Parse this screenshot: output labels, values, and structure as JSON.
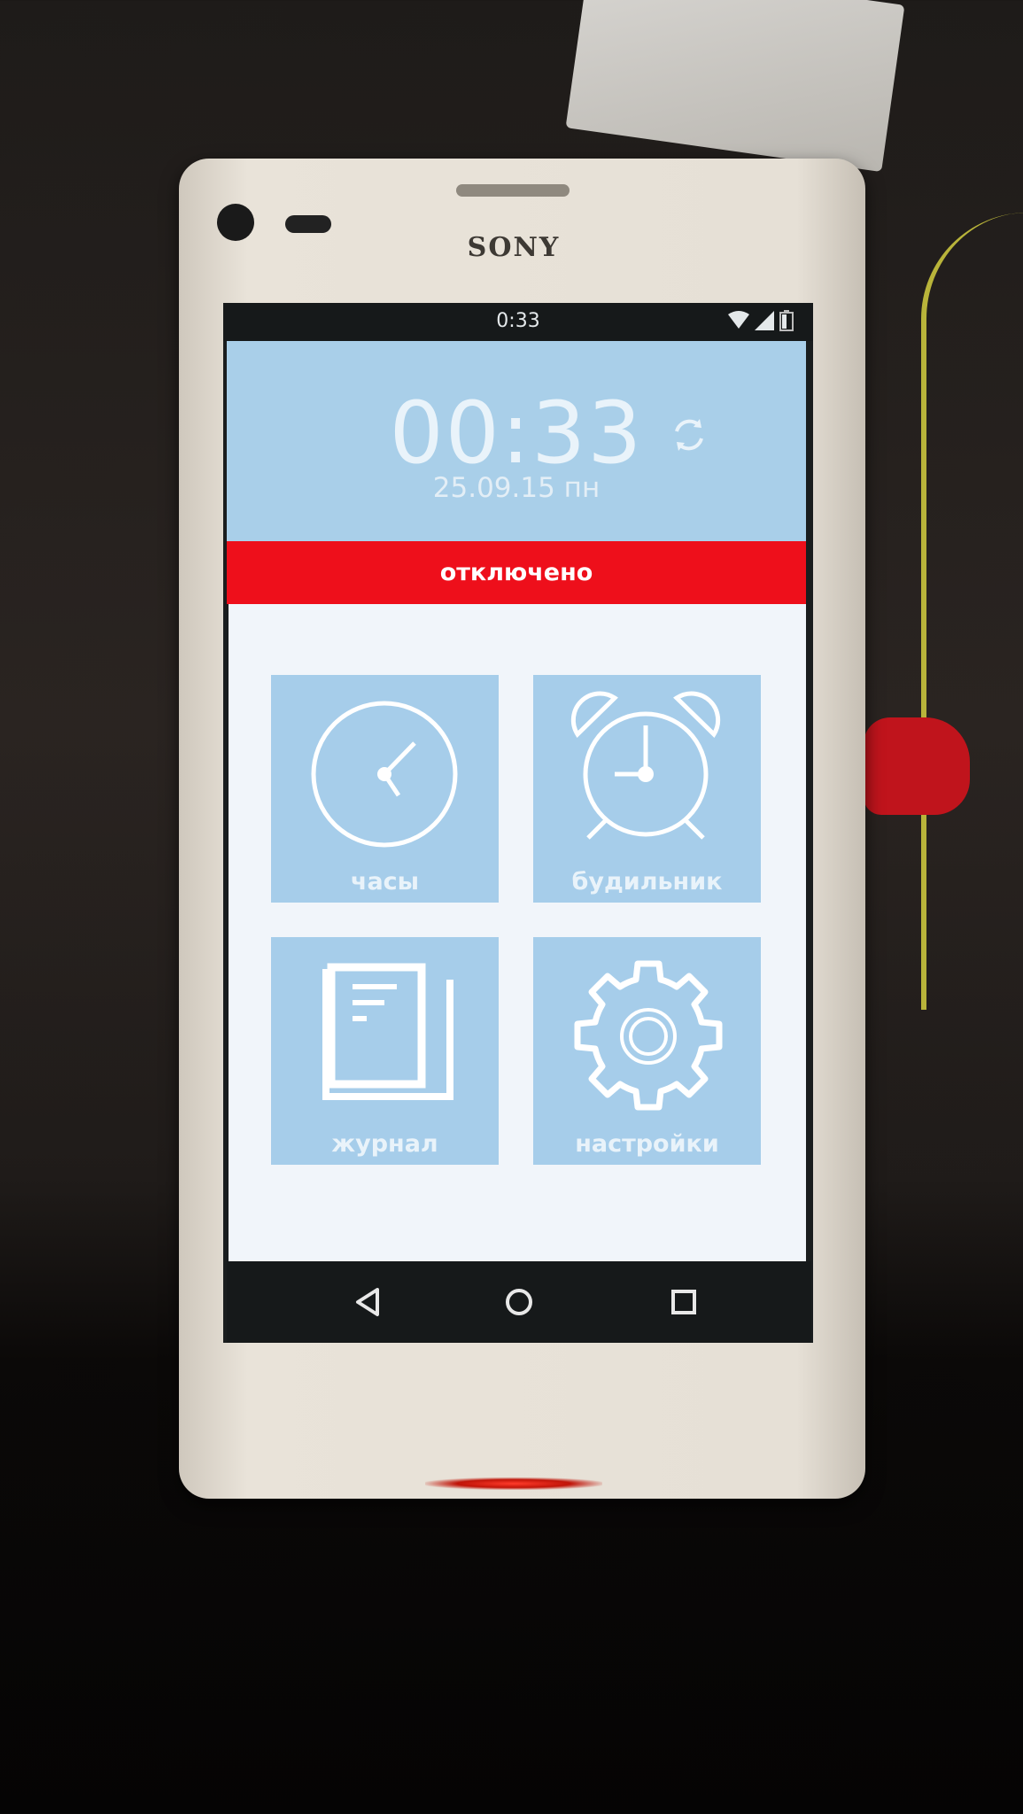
{
  "device": {
    "brand": "SONY"
  },
  "status_bar": {
    "time": "0:33",
    "icons": [
      "wifi-icon",
      "signal-icon",
      "battery-icon"
    ]
  },
  "header": {
    "time": "00:33",
    "date": "25.09.15 пн",
    "sync_icon": "sync-icon"
  },
  "status_banner": {
    "text": "отключено",
    "color": "#ee0f1b"
  },
  "tiles": [
    {
      "label": "часы",
      "icon": "clock-icon"
    },
    {
      "label": "будильник",
      "icon": "alarm-clock-icon"
    },
    {
      "label": "журнал",
      "icon": "journal-book-icon"
    },
    {
      "label": "настройки",
      "icon": "gear-icon"
    }
  ],
  "navigation": {
    "back": "back-icon",
    "home": "home-icon",
    "recents": "recents-icon"
  },
  "colors": {
    "header": "#a9cfe9",
    "tile": "#a6cdea",
    "banner": "#ee0f1b"
  }
}
